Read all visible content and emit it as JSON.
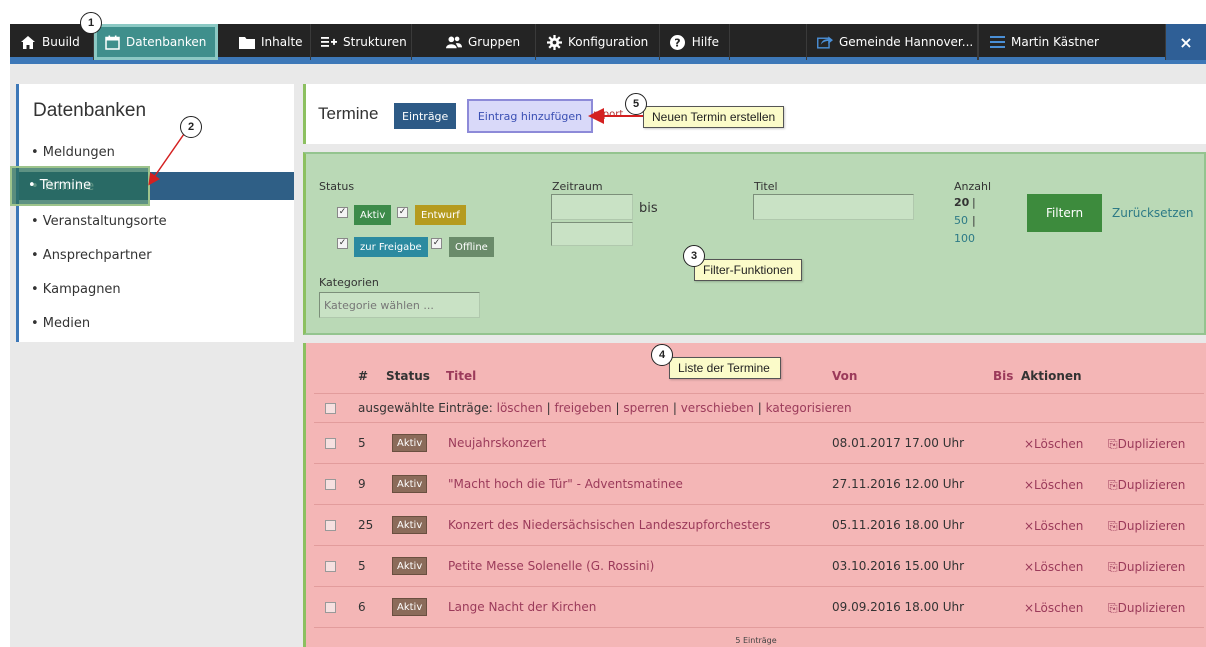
{
  "nav": {
    "brand": "Buuild",
    "datenbanken": "Datenbanken",
    "inhalte": "Inhalte",
    "strukturen": "Strukturen",
    "gruppen": "Gruppen",
    "konfiguration": "Konfiguration",
    "hilfe": "Hilfe",
    "gemeinde": "Gemeinde Hannover...",
    "user": "Martin Kästner",
    "close": "×"
  },
  "sidebar": {
    "title": "Datenbanken",
    "items": [
      {
        "label": "• Meldungen"
      },
      {
        "label": "• Termine"
      },
      {
        "label": "• Veranstaltungsorte"
      },
      {
        "label": "• Ansprechpartner"
      },
      {
        "label": "• Kampagnen"
      },
      {
        "label": "• Medien"
      }
    ]
  },
  "header": {
    "title": "Termine",
    "entries_btn": "Einträge",
    "add_btn": "Eintrag hinzufügen",
    "partial": "mport"
  },
  "filter": {
    "status_label": "Status",
    "tags": [
      "Aktiv",
      "Entwurf",
      "zur Freigabe",
      "Offline"
    ],
    "zeitraum_label": "Zeitraum",
    "bis": "bis",
    "titel_label": "Titel",
    "anzahl_label": "Anzahl",
    "anzahl_opts": [
      "20",
      "50",
      "100"
    ],
    "kategorien_label": "Kategorien",
    "kategorien_placeholder": "Kategorie wählen ...",
    "filter_btn": "Filtern",
    "reset_link": "Zurücksetzen",
    "separator": "|"
  },
  "list": {
    "headers": {
      "num": "#",
      "status": "Status",
      "titel": "Titel",
      "von": "Von",
      "bis": "Bis",
      "aktionen": "Aktionen"
    },
    "bulk": {
      "prefix": "ausgewählte Einträge:",
      "actions": [
        "löschen",
        "freigeben",
        "sperren",
        "verschieben",
        "kategorisieren"
      ],
      "sep": "|"
    },
    "rows": [
      {
        "id": "5",
        "status": "Aktiv",
        "title": "Neujahrskonzert",
        "date": "08.01.2017 17.00 Uhr",
        "delete": "×Löschen",
        "duplicate": "⎘Duplizieren"
      },
      {
        "id": "9",
        "status": "Aktiv",
        "title": "\"Macht hoch die Tür\" - Adventsmatinee",
        "date": "27.11.2016 12.00 Uhr",
        "delete": "×Löschen",
        "duplicate": "⎘Duplizieren"
      },
      {
        "id": "25",
        "status": "Aktiv",
        "title": "Konzert des Niedersächsischen Landeszupforchesters",
        "date": "05.11.2016 18.00 Uhr",
        "delete": "×Löschen",
        "duplicate": "⎘Duplizieren"
      },
      {
        "id": "5",
        "status": "Aktiv",
        "title": "Petite Messe Solenelle (G. Rossini)",
        "date": "03.10.2016 15.00 Uhr",
        "delete": "×Löschen",
        "duplicate": "⎘Duplizieren"
      },
      {
        "id": "6",
        "status": "Aktiv",
        "title": "Lange Nacht der Kirchen",
        "date": "09.09.2016 18.00 Uhr",
        "delete": "×Löschen",
        "duplicate": "⎘Duplizieren"
      }
    ],
    "footer": "5 Einträge"
  },
  "callouts": {
    "c3": "Filter-Funktionen",
    "c4": "Liste der Termine",
    "c5": "Neuen Termin erstellen",
    "n1": "1",
    "n2": "2",
    "n3": "3",
    "n4": "4",
    "n5": "5"
  },
  "colors": {
    "topbar": "#242424",
    "accent_blue": "#3d78b8",
    "active_nav": "#3f8f8c",
    "filter_bg": "#bad9b6",
    "list_bg": "#f4b6b6",
    "callout_bg": "#fbfbc9",
    "arrow": "#d42020",
    "badge": "#8b6b5a"
  }
}
